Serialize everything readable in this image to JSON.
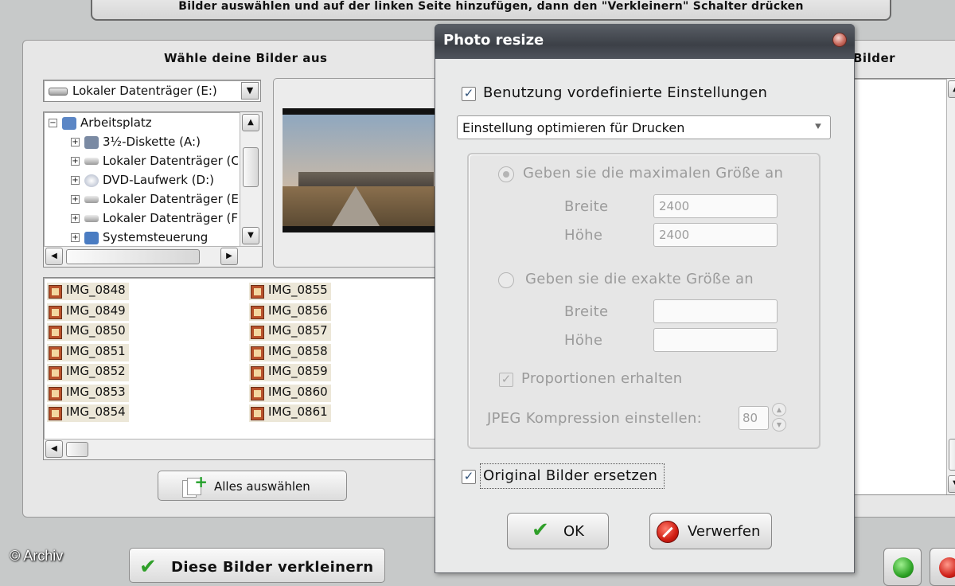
{
  "banner": {
    "text": "Bilder auswählen und auf der linken Seite hinzufügen, dann den \"Verkleinern\" Schalter drücken"
  },
  "left_panel": {
    "title": "Wähle deine Bilder aus",
    "drive_select": {
      "value": "Lokaler Datenträger (E:)",
      "icon": "drive-icon"
    },
    "tree": {
      "items": [
        {
          "label": "Arbeitsplatz",
          "expander": "−",
          "icon": "computer-icon"
        },
        {
          "label": "3½-Diskette (A:)",
          "expander": "+",
          "icon": "floppy-icon"
        },
        {
          "label": "Lokaler Datenträger (C:)",
          "expander": "+",
          "icon": "drive-icon"
        },
        {
          "label": "DVD-Laufwerk (D:)",
          "expander": "+",
          "icon": "dvd-icon"
        },
        {
          "label": "Lokaler Datenträger (E:)",
          "expander": "+",
          "icon": "drive-icon"
        },
        {
          "label": "Lokaler Datenträger (F:)",
          "expander": "+",
          "icon": "drive-icon"
        },
        {
          "label": "Systemsteuerung",
          "expander": "+",
          "icon": "control-panel-icon"
        }
      ]
    },
    "files": {
      "column1": [
        "IMG_0848",
        "IMG_0849",
        "IMG_0850",
        "IMG_0851",
        "IMG_0852",
        "IMG_0853",
        "IMG_0854"
      ],
      "column2": [
        "IMG_0855",
        "IMG_0856",
        "IMG_0857",
        "IMG_0858",
        "IMG_0859",
        "IMG_0860",
        "IMG_0861"
      ]
    },
    "select_all_label": "Alles auswählen"
  },
  "right_panel": {
    "title": "Bilder"
  },
  "shrink_button_label": "Diese Bilder verkleinern",
  "copyright": "© Archiv",
  "dialog": {
    "title": "Photo resize",
    "use_presets": {
      "label": "Benutzung vordefinierte Einstellungen",
      "checked": true
    },
    "preset_select": {
      "value": "Einstellung optimieren für Drucken"
    },
    "max_size": {
      "label": "Geben sie die maximalen Größe an",
      "selected": true,
      "width_label": "Breite",
      "width_value": "2400",
      "height_label": "Höhe",
      "height_value": "2400"
    },
    "exact_size": {
      "label": "Geben sie die exakte Größe an",
      "selected": false,
      "width_label": "Breite",
      "width_value": "",
      "height_label": "Höhe",
      "height_value": ""
    },
    "keep_proportions": {
      "label": "Proportionen erhalten",
      "checked": true
    },
    "jpeg": {
      "label": "JPEG Kompression einstellen:",
      "value": "80"
    },
    "replace_originals": {
      "label": "Original Bilder ersetzen",
      "checked": true
    },
    "ok_label": "OK",
    "cancel_label": "Verwerfen"
  },
  "colors": {
    "accent_green": "#2f9f29",
    "cancel_red": "#d01d12",
    "titlebar": "#3c4047"
  }
}
